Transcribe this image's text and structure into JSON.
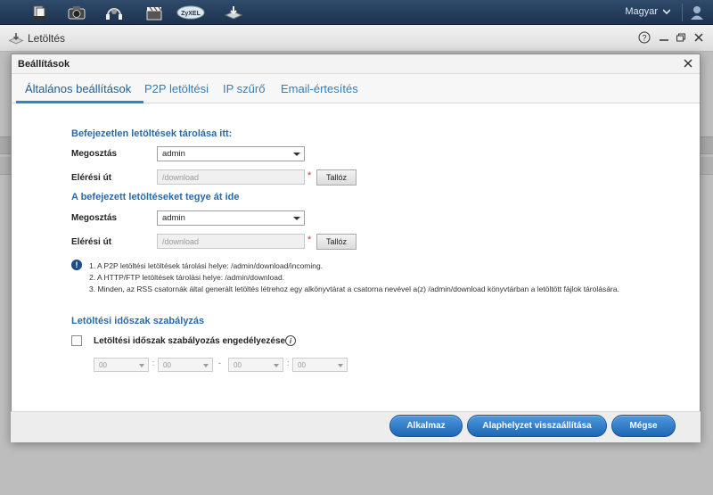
{
  "taskbar": {
    "apps": [
      {
        "icon": "file-manager-icon"
      },
      {
        "icon": "photo-camera-icon"
      },
      {
        "icon": "music-headphones-icon"
      },
      {
        "icon": "video-clapperboard-icon"
      },
      {
        "icon": "zyxel-logo-icon"
      },
      {
        "icon": "download-manager-icon"
      }
    ],
    "language": "Magyar",
    "user_icon": "user-icon"
  },
  "app_window": {
    "title": "Letöltés"
  },
  "dialog": {
    "title": "Beállítások",
    "tabs": [
      {
        "label": "Általános beállítások",
        "active": true
      },
      {
        "label": "P2P letöltési",
        "active": false
      },
      {
        "label": "IP szűrő",
        "active": false
      },
      {
        "label": "Email-értesítés",
        "active": false
      }
    ],
    "incomplete": {
      "heading": "Befejezetlen letöltések tárolása itt:",
      "share_label": "Megosztás",
      "share_value": "admin",
      "path_label": "Elérési út",
      "path_placeholder": "/download",
      "required_mark": "*",
      "browse_label": "Tallóz"
    },
    "complete": {
      "heading": "A befejezett letöltéseket tegye át ide",
      "share_label": "Megosztás",
      "share_value": "admin",
      "path_label": "Elérési út",
      "path_placeholder": "/download",
      "required_mark": "*",
      "browse_label": "Tallóz"
    },
    "notes": [
      "1. A P2P letöltési letöltések tárolási helye: /admin/download/incoming.",
      "2. A HTTP/FTP letöltések tárolási helye: /admin/download.",
      "3. Minden, az RSS csatornák által generált letöltés létrehoz egy alkönyvtárat a csatorna nevével a(z) /admin/download könyvtárban a letöltött fájlok tárolására."
    ],
    "schedule": {
      "heading": "Letöltési időszak szabályzás",
      "checkbox_label": "Letöltési időszak szabályozás engedélyezése",
      "checked": false,
      "start_hour": "00",
      "start_minute": "00",
      "end_hour": "00",
      "end_minute": "00",
      "time_sep": ":",
      "range_sep": "-"
    },
    "buttons": {
      "apply": "Alkalmaz",
      "reset": "Alaphelyzet visszaállítása",
      "cancel": "Mégse"
    }
  },
  "colors": {
    "accent": "#2f86d0",
    "button_primary": "#1e66b4",
    "section_title": "#2a6aa8"
  }
}
